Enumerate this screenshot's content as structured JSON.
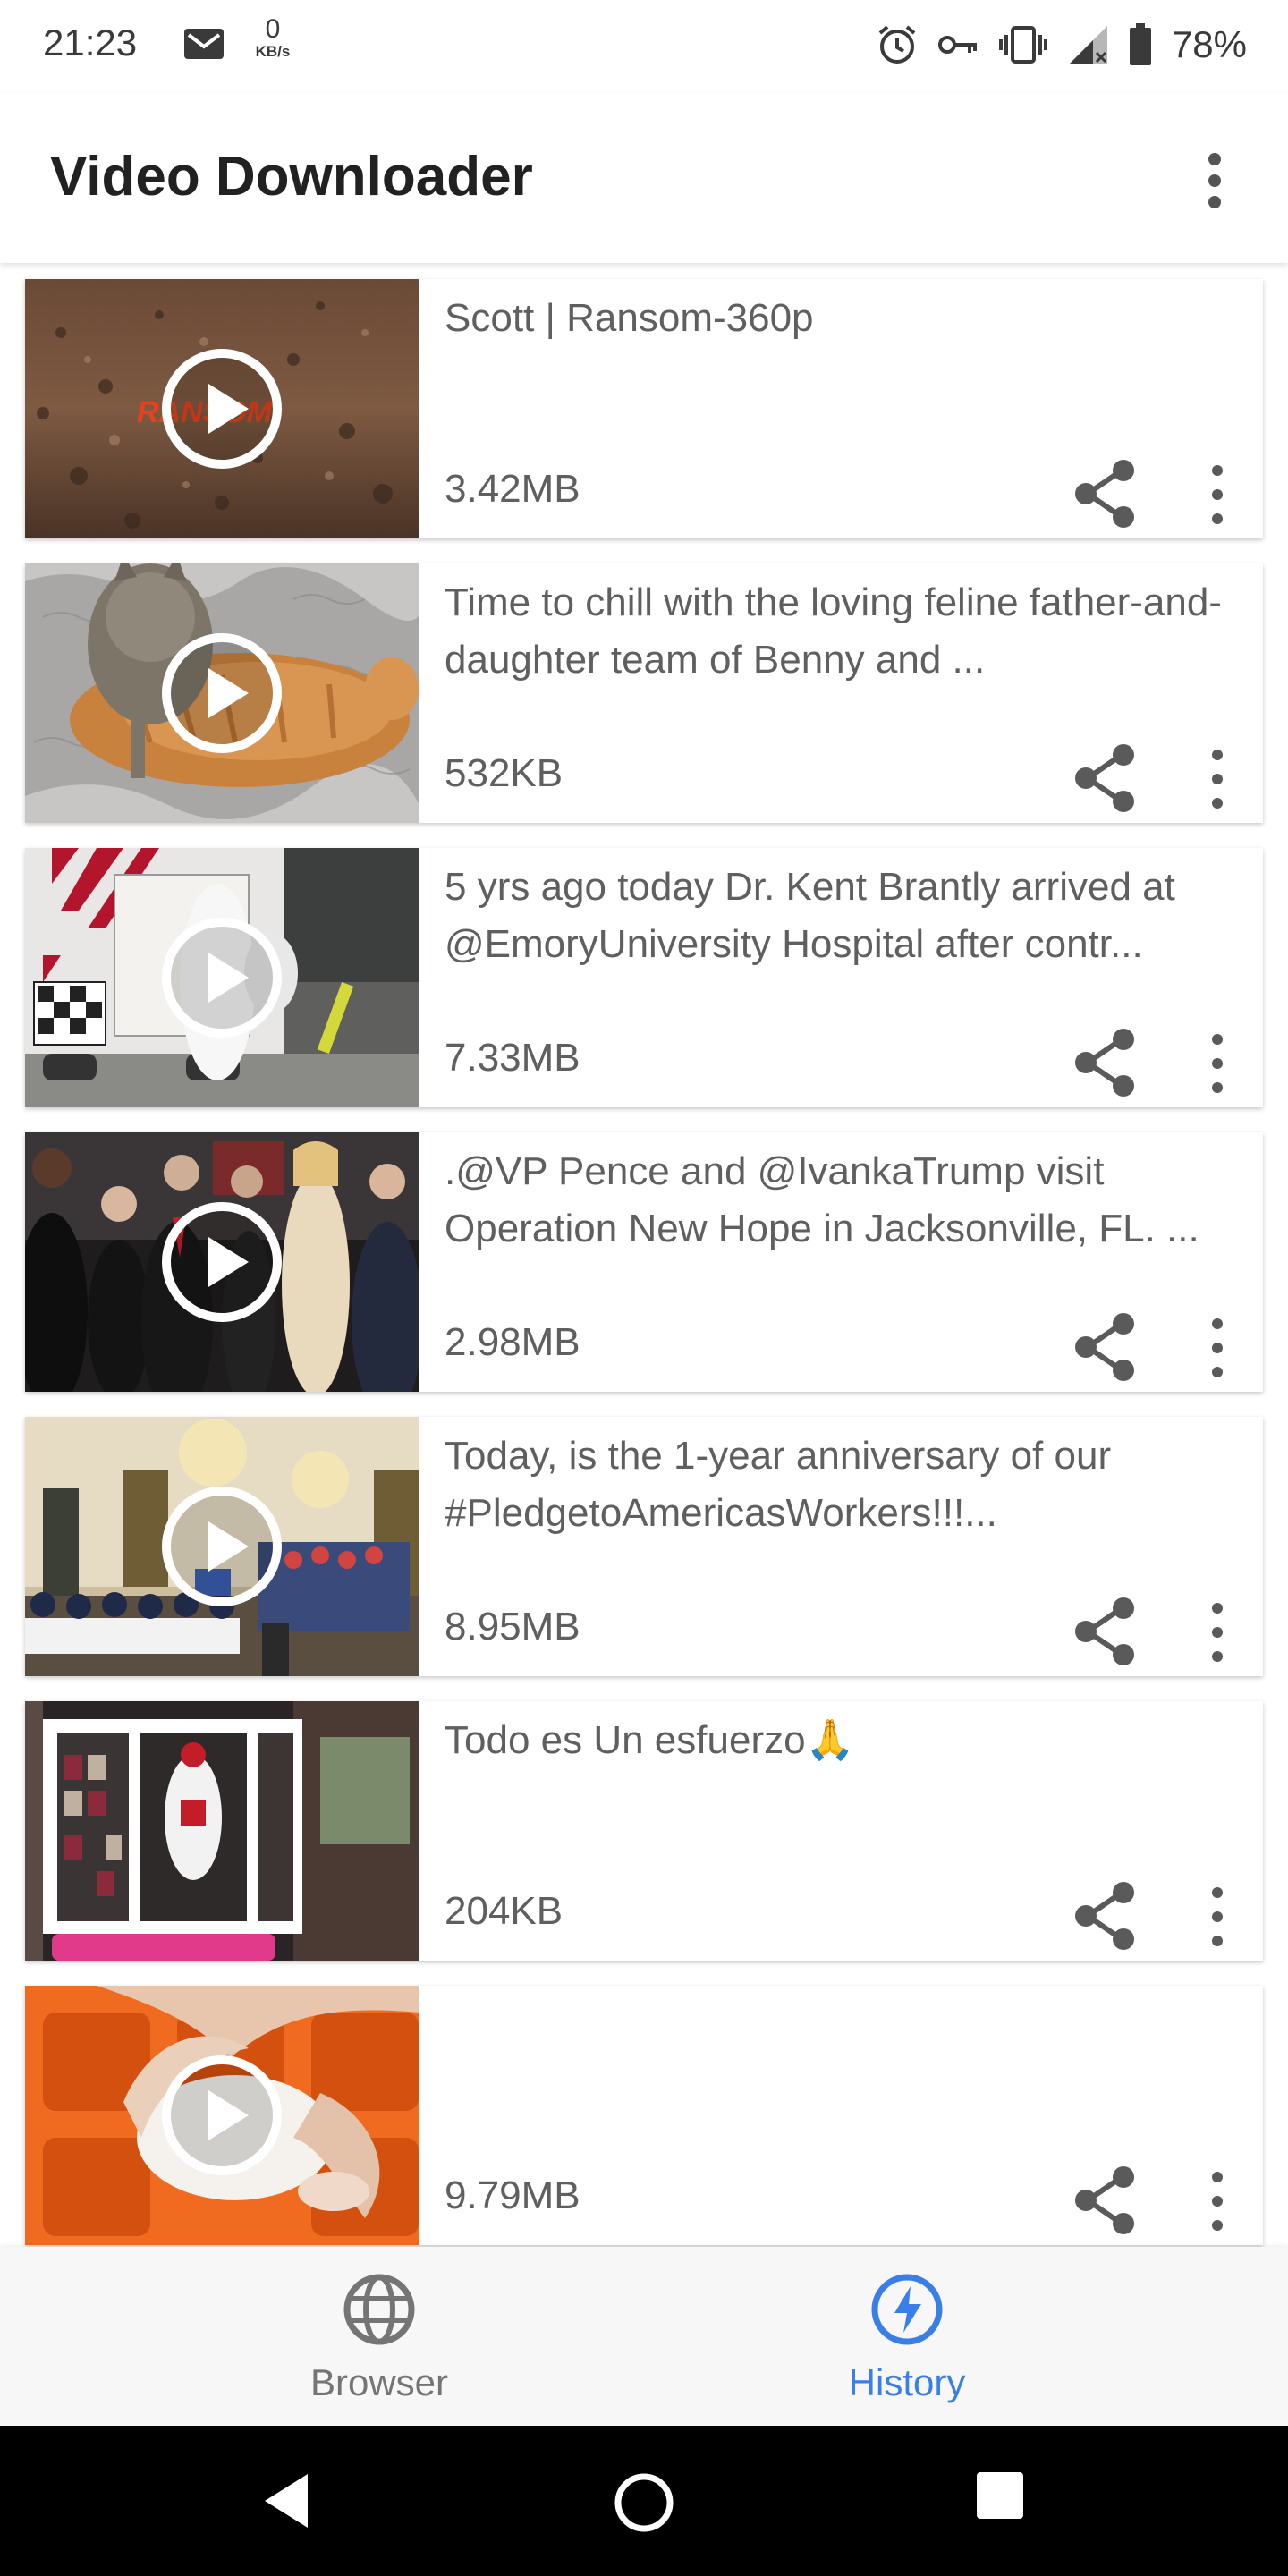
{
  "status_bar": {
    "time": "21:23",
    "net_speed_value": "0",
    "net_speed_unit": "KB/s",
    "battery": "78%",
    "icons": [
      "mail-icon",
      "alarm-icon",
      "vpn-key-icon",
      "vibrate-icon",
      "signal-icon",
      "battery-icon"
    ]
  },
  "app_bar": {
    "title": "Video Downloader",
    "menu_icon": "more-vertical-icon"
  },
  "videos": [
    {
      "title": "Scott | Ransom-360p",
      "size": "3.42MB"
    },
    {
      "title": "Time to chill with the loving feline father-and-daughter team of Benny and ...",
      "size": "532KB"
    },
    {
      "title": "5 yrs ago today Dr. Kent Brantly arrived at @EmoryUniversity Hospital after contr...",
      "size": "7.33MB"
    },
    {
      "title": ".@VP Pence and @IvankaTrump visit Operation New Hope in Jacksonville, FL. ...",
      "size": "2.98MB"
    },
    {
      "title": "Today, is the 1-year anniversary of our #PledgetoAmericasWorkers!!!...",
      "size": "8.95MB"
    },
    {
      "title": "Todo es Un esfuerzo🙏",
      "size": "204KB"
    },
    {
      "title": "",
      "size": "9.79MB"
    }
  ],
  "thumbnail_overlay_text": [
    "RANSOM"
  ],
  "bottom_nav": {
    "browser_label": "Browser",
    "history_label": "History",
    "active": "History",
    "active_color": "#3a7ee8",
    "inactive_color": "#757575"
  },
  "system_nav": {
    "icons": [
      "back-icon",
      "home-icon",
      "recents-icon"
    ]
  }
}
